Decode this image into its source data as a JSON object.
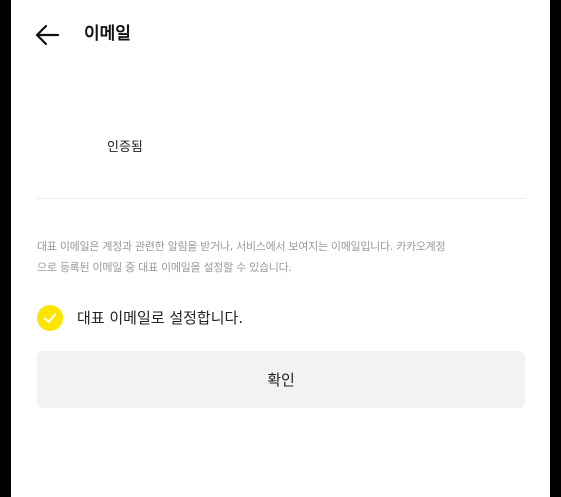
{
  "header": {
    "back_icon": "arrow-left-icon",
    "title": "이메일"
  },
  "email": {
    "status": "인증됨"
  },
  "notice": {
    "line1": "대표 이메일은 계정과 관련한 알림을 받거나, 서비스에서 보여지는 이메일입니다. 카카오계정",
    "line2": "으로 등록된 이메일 중 대표 이메일을 설정할 수 있습니다."
  },
  "primary_option": {
    "checked": true,
    "icon": "check-icon",
    "label": "대표 이메일로 설정합니다."
  },
  "confirm": {
    "label": "확인"
  },
  "colors": {
    "accent": "#fee500",
    "background": "#ffffff",
    "frame": "#000000",
    "button_bg": "#f2f2f2",
    "muted_text": "#9a9a9a"
  }
}
